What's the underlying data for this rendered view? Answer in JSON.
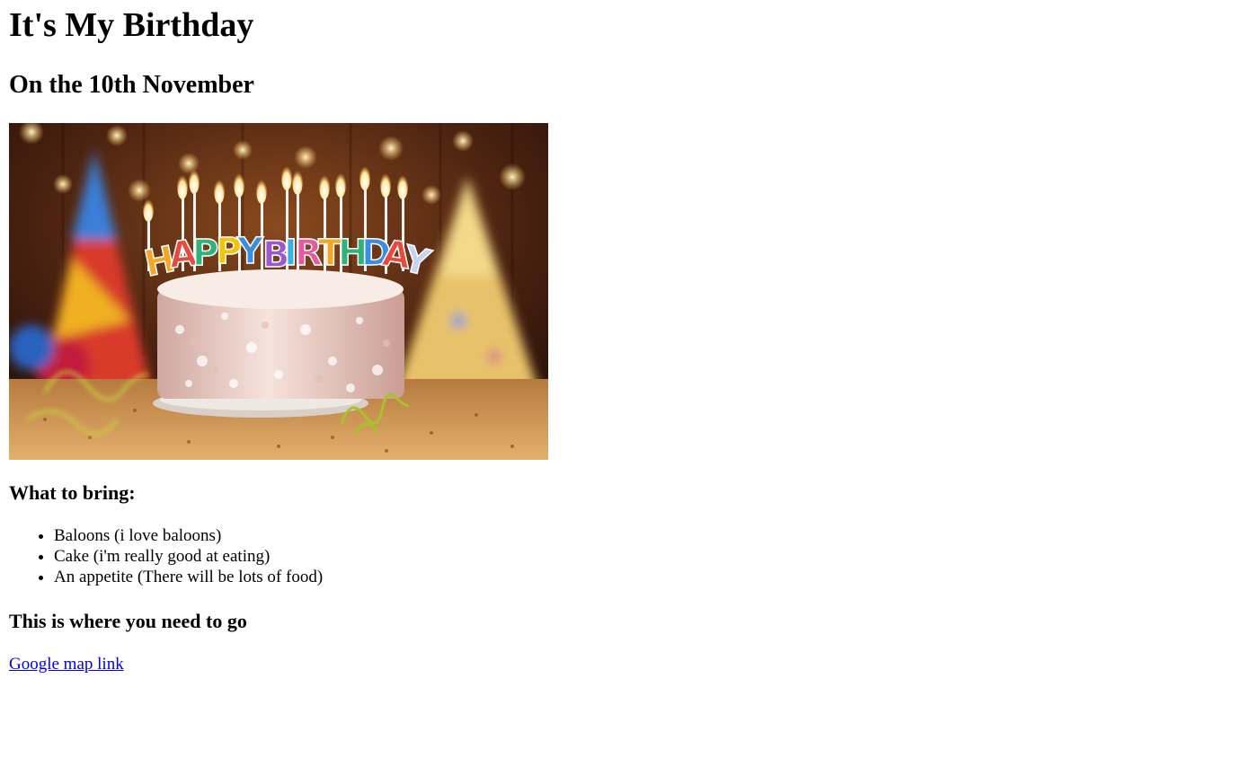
{
  "page": {
    "title": "It's My Birthday",
    "subtitle": "On the 10th November"
  },
  "image": {
    "alt": "birthday cake photo",
    "cake_text": "HAPPY BIRTHDAY"
  },
  "bring": {
    "heading": "What to bring:",
    "items": [
      "Baloons (i love baloons)",
      "Cake (i'm really good at eating)",
      "An appetite (There will be lots of food)"
    ]
  },
  "location": {
    "heading": "This is where you need to go",
    "link_text": "Google map link"
  },
  "colors": {
    "link": "#0000ee",
    "text": "#000000",
    "background": "#ffffff"
  }
}
